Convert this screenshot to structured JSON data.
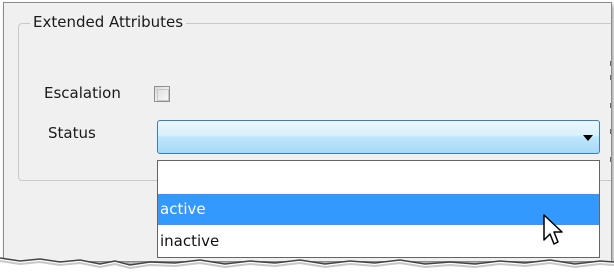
{
  "groupbox": {
    "title": "Extended Attributes"
  },
  "fields": {
    "escalation_label": "Escalation",
    "escalation_checked": false,
    "status_label": "Status",
    "status_value": ""
  },
  "dropdown": {
    "options": [
      "",
      "active",
      "inactive"
    ],
    "highlighted_index": 1
  },
  "icons": {
    "dropdown_arrow": "chevron-down-icon",
    "mouse_cursor": "arrow-cursor-icon"
  },
  "colors": {
    "selection": "#3399ff",
    "combo_border": "#3c7fb1",
    "window_bg": "#f0f0f0"
  }
}
